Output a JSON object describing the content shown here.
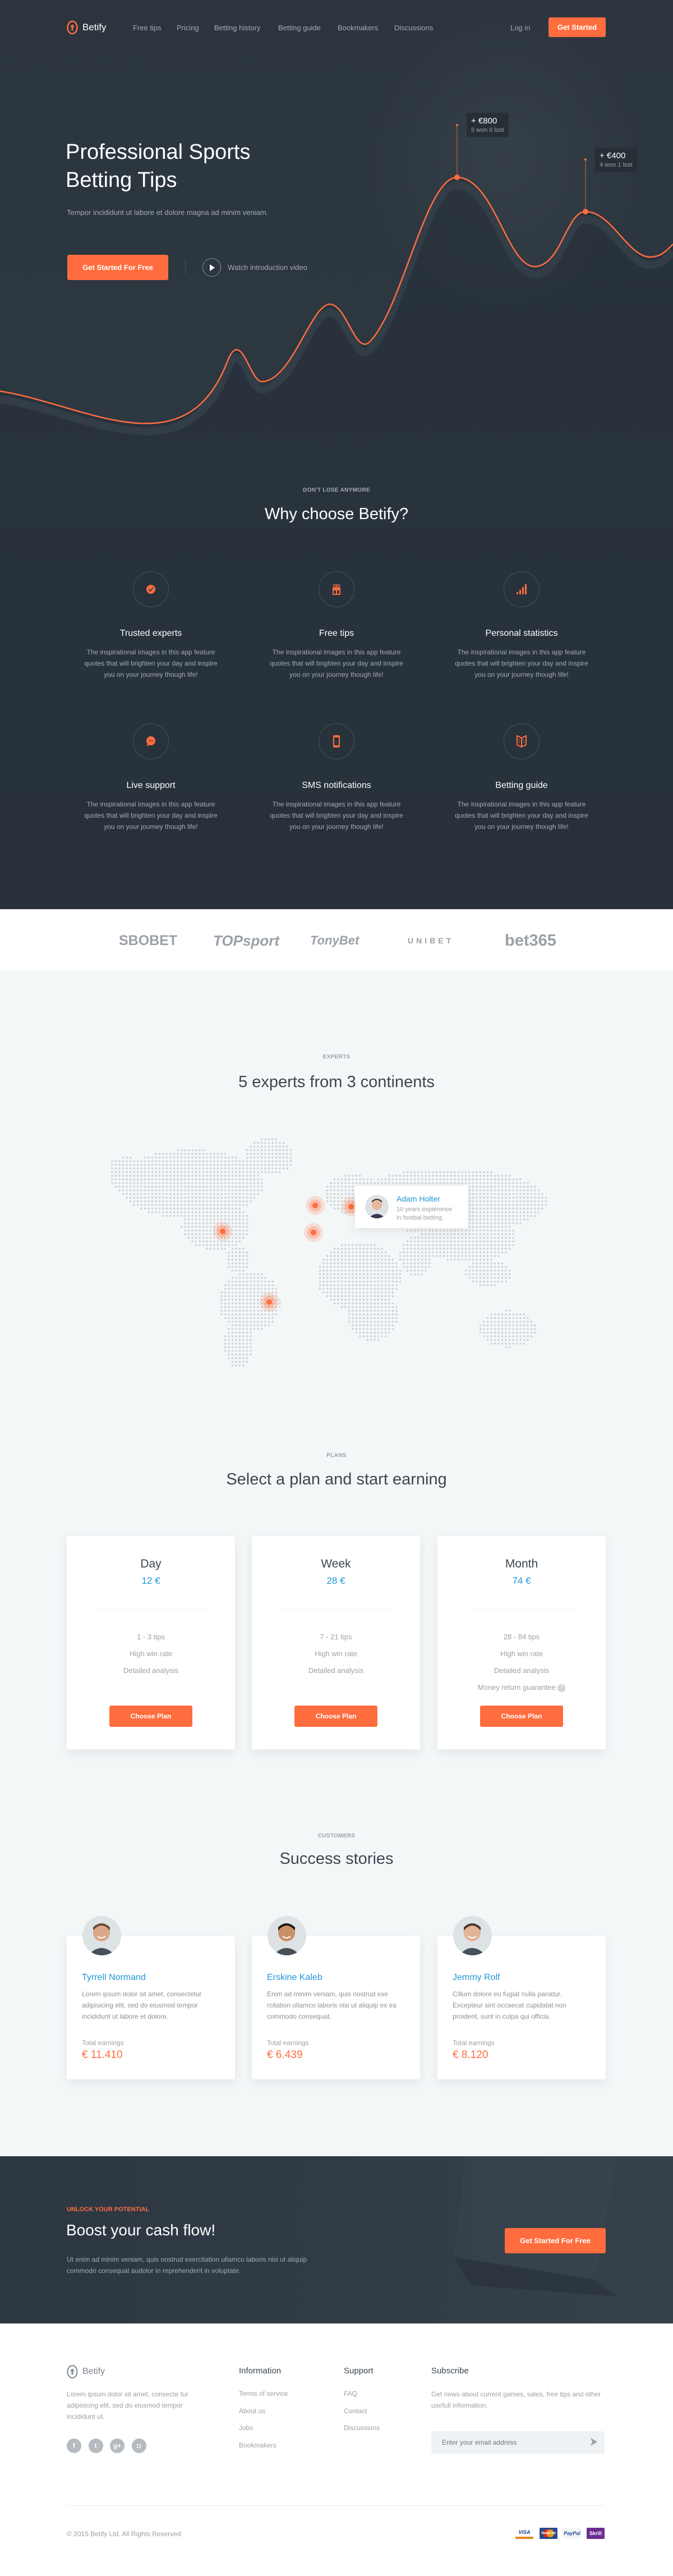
{
  "colors": {
    "accent": "#ff6d3f",
    "link_blue": "#1f96d8",
    "dark_bg": "#2c353e",
    "light_bg": "#f4f7f8"
  },
  "nav": {
    "brand": "Betify",
    "links": [
      "Free tips",
      "Pricing",
      "Betting history",
      "Betting guide",
      "Bookmakers",
      "Discussions"
    ],
    "login": "Log in",
    "cta": "Get Started"
  },
  "hero": {
    "title_line1": "Professional Sports",
    "title_line2": "Betting Tips",
    "subtitle": "Tempor incididunt ut labore et dolore magna ad minim veniam.",
    "cta": "Get Started For Free",
    "video_link": "Watch introduction video",
    "tooltips": [
      {
        "amount": "+ €800",
        "record": "5 won 0 lost"
      },
      {
        "amount": "+ €400",
        "record": "4 won 1 lost"
      }
    ]
  },
  "features": {
    "eyebrow": "Don't lose anymore",
    "title": "Why choose Betify?",
    "items": [
      {
        "icon": "check-badge-icon",
        "title": "Trusted experts",
        "text": "The inspirational images in this app feature quotes that will brighten your day and inspire you on your journey though life!"
      },
      {
        "icon": "gift-icon",
        "title": "Free tips",
        "text": "The inspirational images in this app feature quotes that will brighten your day and inspire you on your journey though life!"
      },
      {
        "icon": "signal-bars-icon",
        "title": "Personal statistics",
        "text": "The inspirational images in this app feature quotes that will brighten your day and inspire you on your journey though life!"
      },
      {
        "icon": "chat-bubble-icon",
        "title": "Live support",
        "text": "The inspirational images in this app feature quotes that will brighten your day and inspire you on your journey though life!"
      },
      {
        "icon": "phone-icon",
        "title": "SMS notifications",
        "text": "The inspirational images in this app feature quotes that will brighten your day and inspire you on your journey though life!"
      },
      {
        "icon": "book-icon",
        "title": "Betting guide",
        "text": "The inspirational images in this app feature quotes that will brighten your day and inspire you on your journey though life!"
      }
    ]
  },
  "bookmakers": [
    "SBOBET",
    "TOPsport",
    "TonyBet",
    "UNIBET",
    "bet365"
  ],
  "experts": {
    "eyebrow": "Experts",
    "title": "5 experts from 3 continents",
    "card": {
      "name": "Adam Holter",
      "line1": "10 years expierence",
      "line2": "in footbal betting."
    }
  },
  "plans": {
    "eyebrow": "Plans",
    "title": "Select a plan and start earning",
    "button": "Choose Plan",
    "items": [
      {
        "name": "Day",
        "price": "12 €",
        "features": [
          "1 - 3 tips",
          "High win rate",
          "Detailed analysis"
        ]
      },
      {
        "name": "Week",
        "price": "28 €",
        "features": [
          "7 - 21 tips",
          "High win rate",
          "Detailed analysis"
        ]
      },
      {
        "name": "Month",
        "price": "74 €",
        "features": [
          "28 - 84 tips",
          "High win rate",
          "Detailed analysis",
          "Money return guarantee"
        ]
      }
    ]
  },
  "stories": {
    "eyebrow": "Customers",
    "title": "Success stories",
    "earnings_label": "Total earnings",
    "items": [
      {
        "name": "Tyrrell Normand",
        "text": "Lorem ipsum dolor sit amet, consectetur adipisicing elit, sed do eiusmod tempor incididunt ut labore et dolore.",
        "amount": "€ 11.410"
      },
      {
        "name": "Erskine Kaleb",
        "text": "Enim ad minim veniam, quis nostrud exe rcitation ullamco laboris nisi ut aliquip ex ea commodo consequat.",
        "amount": "€ 6.439"
      },
      {
        "name": "Jemmy Rolf",
        "text": "Cillum dolore eu fugiat nulla pariatur. Excepteur sint occaecat cupidatat non proident, sunt in culpa qui officia.",
        "amount": "€ 8.120"
      }
    ]
  },
  "cta": {
    "eyebrow": "Unlock your potential",
    "title": "Boost your cash flow!",
    "text": "Ut enim ad minim veniam, quis nostrud exercitation ullamco laboris nisi ut aliquip commodo consequat audolor in reprehenderit in voluptate.",
    "button": "Get Started For Free"
  },
  "footer": {
    "brand": "Betify",
    "about": "Lorem ipsum dolor sit amet, consecte tur adipisicing elit, sed do eiusmod tempor incididunt ut.",
    "information": {
      "title": "Information",
      "links": [
        "Terms of service",
        "About us",
        "Jobs",
        "Bookmakers"
      ]
    },
    "support": {
      "title": "Support",
      "links": [
        "FAQ",
        "Contact",
        "Discussions"
      ]
    },
    "subscribe": {
      "title": "Subscribe",
      "text": "Get news about current games, sales, free tips and other usefull information.",
      "placeholder": "Enter your email address"
    },
    "social": [
      "facebook-icon",
      "twitter-icon",
      "google-plus-icon",
      "instagram-icon"
    ],
    "copyright": "© 2015 Betify Ltd. All Rights Reserved",
    "payments": [
      "VISA",
      "MasterCard",
      "PayPal",
      "Skrill"
    ]
  }
}
